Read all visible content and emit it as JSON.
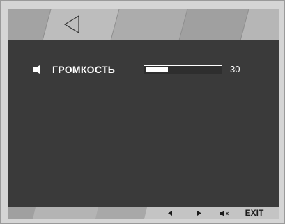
{
  "header": {
    "back_icon": "back-triangle-icon"
  },
  "volume": {
    "icon": "speaker-icon",
    "label": "ГРОМКОСТЬ",
    "value": "30",
    "level_percent": 30
  },
  "footer": {
    "left_icon": "left-arrow-icon",
    "right_icon": "right-arrow-icon",
    "mute_icon": "mute-icon",
    "exit_label": "EXIT"
  },
  "colors": {
    "panel": "#3a3a3a",
    "bar": "#a6a6a6",
    "text": "#ffffff"
  }
}
